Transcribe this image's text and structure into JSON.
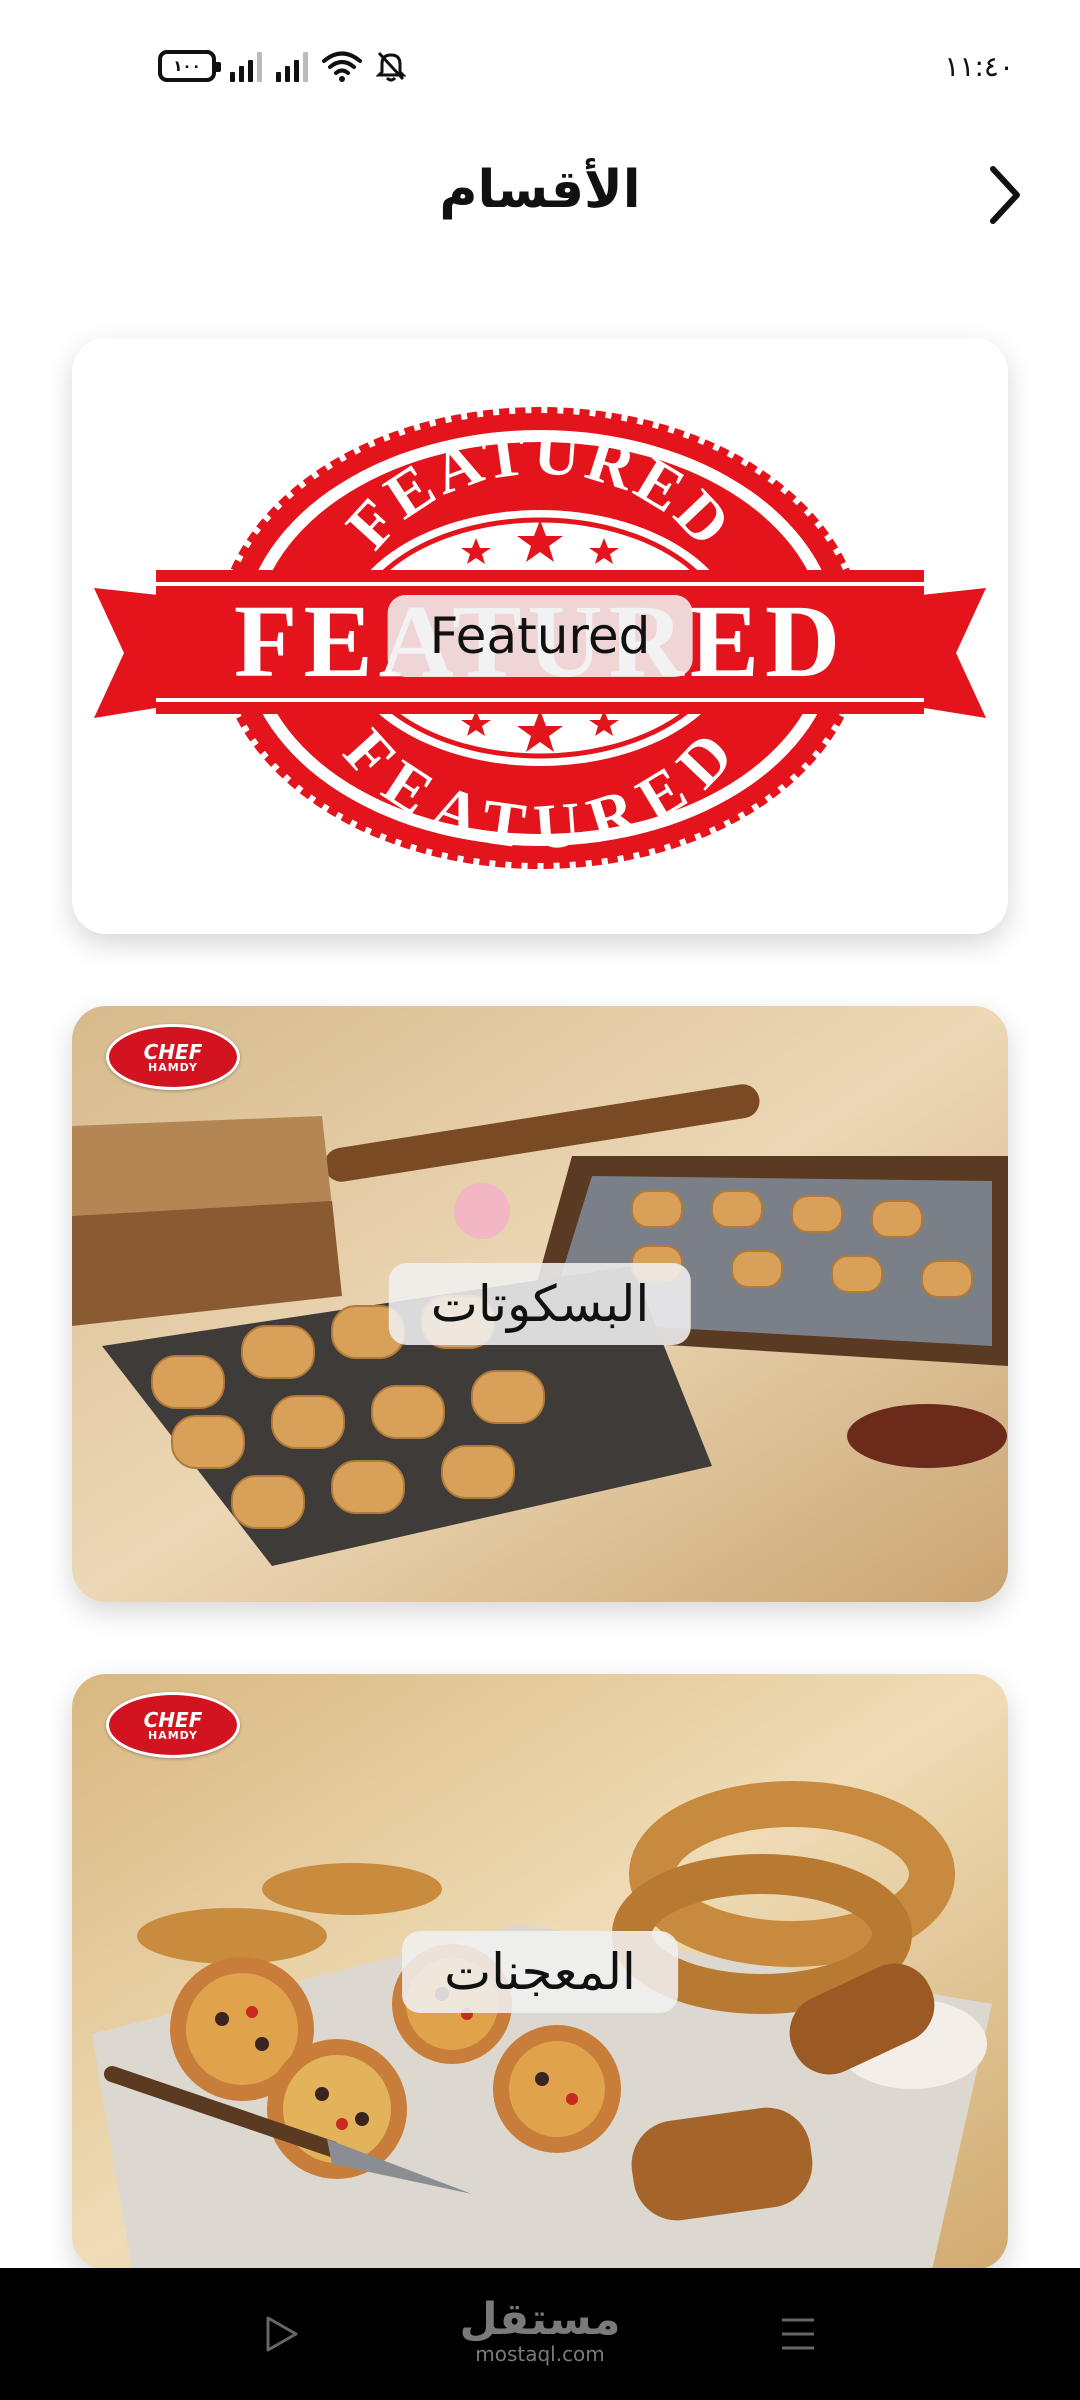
{
  "status_bar": {
    "time": "١١:٤٠",
    "battery": "١٠٠",
    "icons": [
      "battery-icon",
      "signal-icon",
      "signal-icon",
      "wifi-icon",
      "bell-off-icon"
    ]
  },
  "header": {
    "title": "الأقسام",
    "back_icon": "chevron-right-icon"
  },
  "categories": [
    {
      "label": "Featured",
      "image": "featured-stamp",
      "badge_text": [
        "FEATURED",
        "FEATURED",
        "FEATURED"
      ]
    },
    {
      "label": "البسكوتات",
      "image": "biscuits-photo",
      "logo_text": [
        "CHEF",
        "HAMDY"
      ]
    },
    {
      "label": "المعجنات",
      "image": "pastries-photo",
      "logo_text": [
        "CHEF",
        "HAMDY"
      ]
    }
  ],
  "nav_bar": {
    "buttons": [
      "play-triangle-icon",
      "menu-lines-icon"
    ],
    "watermark_ar": "مستقل",
    "watermark_en": "mostaql.com"
  },
  "colors": {
    "stamp_red": "#e3141c",
    "background": "#ffffff",
    "nav_background": "#000000"
  }
}
